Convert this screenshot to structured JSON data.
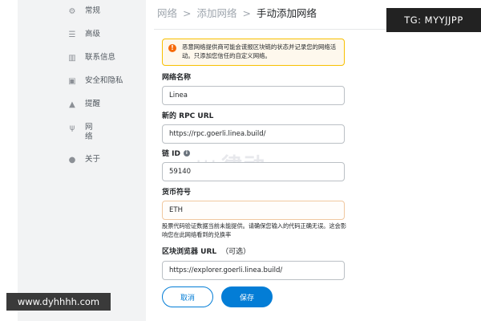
{
  "sidebar": {
    "items": [
      {
        "label": "常规",
        "icon": "gear-icon"
      },
      {
        "label": "高级",
        "icon": "sliders-icon"
      },
      {
        "label": "联系信息",
        "icon": "contacts-book-icon"
      },
      {
        "label": "安全和隐私",
        "icon": "lock-icon"
      },
      {
        "label": "提醒",
        "icon": "bell-icon"
      },
      {
        "label": "网络",
        "icon": "plug-icon"
      },
      {
        "label": "关于",
        "icon": "info-icon"
      }
    ]
  },
  "header": {
    "crumb1": "网络",
    "crumb2": "添加网络",
    "separator": ">",
    "current": "手动添加网络"
  },
  "warning": {
    "text": "恶意网络提供商可能会谎报区块链的状态并记录您的网络活动。只添加您信任的自定义网络。"
  },
  "form": {
    "network_name": {
      "label": "网络名称",
      "value": "Linea"
    },
    "rpc_url": {
      "label": "新的 RPC URL",
      "value": "https://rpc.goerli.linea.build/"
    },
    "chain_id": {
      "label": "链 ID",
      "value": "59140"
    },
    "currency_symbol": {
      "label": "货币符号",
      "value": "ETH"
    },
    "currency_hint": "股票代码验证数据当前未能提供。请确保您输入的代码正确无误。这会影响您在此网络看到的兑换率",
    "explorer_url": {
      "label": "区块浏览器 URL",
      "optional": "（可选）",
      "value": "https://explorer.goerli.linea.build/"
    }
  },
  "buttons": {
    "cancel": "取消",
    "save": "保存"
  },
  "overlays": {
    "tg_badge": "TG: MYYJJPP",
    "site_url": "www.dyhhhh.com",
    "bg_watermark": "律动"
  }
}
